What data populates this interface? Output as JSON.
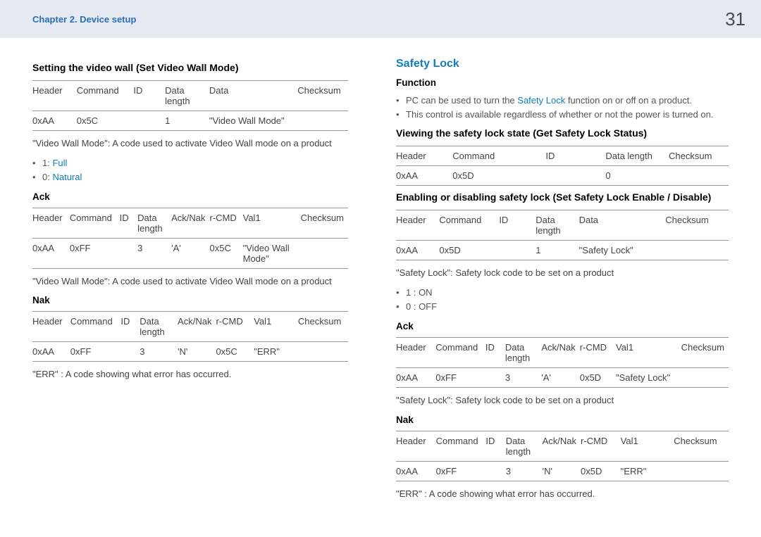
{
  "header": {
    "chapter": "Chapter 2. Device setup",
    "page": "31"
  },
  "left": {
    "title": "Setting the video wall (Set Video Wall Mode)",
    "t1": {
      "h": [
        "Header",
        "Command",
        "ID",
        "Data length",
        "Data",
        "Checksum"
      ],
      "r": [
        "0xAA",
        "0x5C",
        "",
        "1",
        "\"Video Wall Mode\"",
        ""
      ]
    },
    "desc1": "\"Video Wall Mode\": A code used to activate Video Wall mode on a product",
    "bl1a_prefix": "1: ",
    "bl1a_emph": "Full",
    "bl1b_prefix": "0: ",
    "bl1b_emph": "Natural",
    "ack_title": "Ack",
    "t2": {
      "h": [
        "Header",
        "Command",
        "ID",
        "Data length",
        "Ack/Nak",
        "r-CMD",
        "Val1",
        "Checksum"
      ],
      "r": [
        "0xAA",
        "0xFF",
        "",
        "3",
        "'A'",
        "0x5C",
        "\"Video Wall Mode\"",
        ""
      ]
    },
    "desc2": "\"Video Wall Mode\": A code used to activate Video Wall mode on a product",
    "nak_title": "Nak",
    "t3": {
      "h": [
        "Header",
        "Command",
        "ID",
        "Data length",
        "Ack/Nak",
        "r-CMD",
        "Val1",
        "Checksum"
      ],
      "r": [
        "0xAA",
        "0xFF",
        "",
        "3",
        "'N'",
        "0x5C",
        "\"ERR\"",
        ""
      ]
    },
    "desc3": "\"ERR\" : A code showing what error has occurred."
  },
  "right": {
    "title": "Safety Lock",
    "func_title": "Function",
    "func_b1_pre": "PC can be used to turn the ",
    "func_b1_emph": "Safety Lock",
    "func_b1_post": " function on or off on a product.",
    "func_b2": "This control is available regardless of whether or not the power is turned on.",
    "sub1": "Viewing the safety lock state (Get Safety Lock Status)",
    "t1": {
      "h": [
        "Header",
        "Command",
        "ID",
        "Data length",
        "Checksum"
      ],
      "r": [
        "0xAA",
        "0x5D",
        "",
        "0",
        ""
      ]
    },
    "sub2": "Enabling or disabling safety lock (Set Safety Lock Enable / Disable)",
    "t2": {
      "h": [
        "Header",
        "Command",
        "ID",
        "Data length",
        "Data",
        "Checksum"
      ],
      "r": [
        "0xAA",
        "0x5D",
        "",
        "1",
        "\"Safety Lock\"",
        ""
      ]
    },
    "desc1": "\"Safety Lock\": Safety lock code to be set on a product",
    "bl_on": "1 : ON",
    "bl_off": "0 : OFF",
    "ack_title": "Ack",
    "t3": {
      "h": [
        "Header",
        "Command",
        "ID",
        "Data length",
        "Ack/Nak",
        "r-CMD",
        "Val1",
        "Checksum"
      ],
      "r": [
        "0xAA",
        "0xFF",
        "",
        "3",
        "'A'",
        "0x5D",
        "\"Safety Lock\"",
        ""
      ]
    },
    "desc2": "\"Safety Lock\": Safety lock code to be set on a product",
    "nak_title": "Nak",
    "t4": {
      "h": [
        "Header",
        "Command",
        "ID",
        "Data length",
        "Ack/Nak",
        "r-CMD",
        "Val1",
        "Checksum"
      ],
      "r": [
        "0xAA",
        "0xFF",
        "",
        "3",
        "'N'",
        "0x5D",
        "\"ERR\"",
        ""
      ]
    },
    "desc3": "\"ERR\" : A code showing what error has occurred."
  }
}
